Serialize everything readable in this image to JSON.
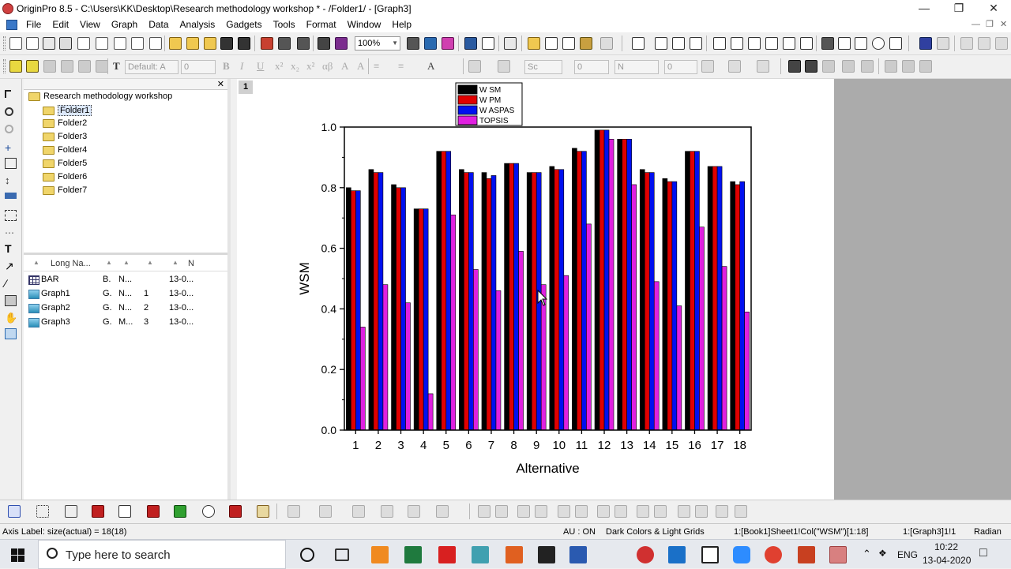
{
  "window": {
    "title": "OriginPro 8.5 - C:\\Users\\KK\\Desktop\\Research methodology workshop * - /Folder1/ - [Graph3]",
    "min_icon": "minimize-icon",
    "restore_icon": "restore-icon",
    "close_icon": "close-icon"
  },
  "menu": [
    "File",
    "Edit",
    "View",
    "Graph",
    "Data",
    "Analysis",
    "Gadgets",
    "Tools",
    "Format",
    "Window",
    "Help"
  ],
  "toolbar": {
    "zoom": "100%",
    "font_name": "Default: A",
    "font_size": "0",
    "line_style": "Sc",
    "line_width": "0",
    "border_width": "N",
    "pattern_width": "0"
  },
  "explorer": {
    "root": "Research methodology workshop",
    "folders": [
      "Folder1",
      "Folder2",
      "Folder3",
      "Folder4",
      "Folder5",
      "Folder6",
      "Folder7"
    ],
    "selected_folder": "Folder1",
    "columns": [
      "Long Na...",
      "N"
    ],
    "rows": [
      {
        "name": "BAR",
        "type": "B.",
        "view": "N...",
        "num": "",
        "date": "13-0..."
      },
      {
        "name": "Graph1",
        "type": "G.",
        "view": "N...",
        "num": "1",
        "date": "13-0..."
      },
      {
        "name": "Graph2",
        "type": "G.",
        "view": "N...",
        "num": "2",
        "date": "13-0..."
      },
      {
        "name": "Graph3",
        "type": "G.",
        "view": "M...",
        "num": "3",
        "date": "13-0..."
      }
    ]
  },
  "graph": {
    "page_number": "1"
  },
  "chart_data": {
    "type": "bar",
    "xlabel": "Alternative",
    "ylabel": "WSM",
    "categories": [
      "1",
      "2",
      "3",
      "4",
      "5",
      "6",
      "7",
      "8",
      "9",
      "10",
      "11",
      "12",
      "13",
      "14",
      "15",
      "16",
      "17",
      "18"
    ],
    "ylim": [
      0,
      1.0
    ],
    "yticks": [
      "0.0",
      "0.2",
      "0.4",
      "0.6",
      "0.8",
      "1.0"
    ],
    "legend_position": "top-center",
    "series": [
      {
        "name": "W SM",
        "color": "#000000",
        "values": [
          0.8,
          0.86,
          0.81,
          0.73,
          0.92,
          0.86,
          0.85,
          0.88,
          0.85,
          0.87,
          0.93,
          0.99,
          0.96,
          0.86,
          0.83,
          0.92,
          0.87,
          0.82
        ]
      },
      {
        "name": "W PM",
        "color": "#e00000",
        "values": [
          0.79,
          0.85,
          0.8,
          0.73,
          0.92,
          0.85,
          0.83,
          0.88,
          0.85,
          0.86,
          0.92,
          0.99,
          0.96,
          0.85,
          0.82,
          0.92,
          0.87,
          0.81
        ]
      },
      {
        "name": "W ASPAS",
        "color": "#0010f0",
        "values": [
          0.79,
          0.85,
          0.8,
          0.73,
          0.92,
          0.85,
          0.84,
          0.88,
          0.85,
          0.86,
          0.92,
          0.99,
          0.96,
          0.85,
          0.82,
          0.92,
          0.87,
          0.82
        ]
      },
      {
        "name": "TOPSIS",
        "color": "#e020e0",
        "values": [
          0.34,
          0.48,
          0.42,
          0.12,
          0.71,
          0.53,
          0.46,
          0.59,
          0.48,
          0.51,
          0.68,
          0.96,
          0.81,
          0.49,
          0.41,
          0.67,
          0.54,
          0.39
        ]
      }
    ]
  },
  "status": {
    "left": "Axis Label: size(actual) = 18(18)",
    "au": "AU : ON",
    "theme": "Dark Colors & Light Grids",
    "column": "1:[Book1]Sheet1!Col(\"WSM\")[1:18]",
    "graph": "1:[Graph3]1!1",
    "units": "Radian"
  },
  "taskbar": {
    "search_placeholder": "Type here to search",
    "lang": "ENG",
    "time": "10:22",
    "date": "13-04-2020"
  }
}
